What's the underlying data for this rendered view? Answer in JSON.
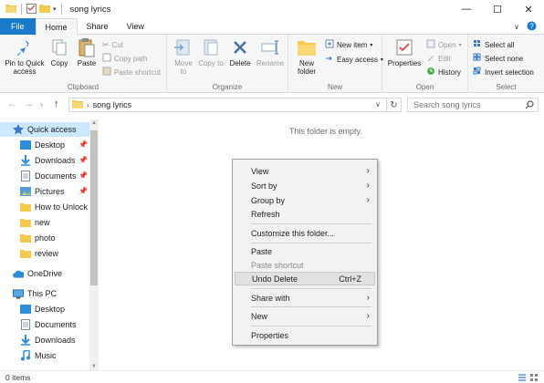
{
  "window": {
    "title": "song lyrics",
    "minimize": "—",
    "maximize": "☐",
    "close": "✕"
  },
  "tabs": [
    "File",
    "Home",
    "Share",
    "View"
  ],
  "ribbon": {
    "clipboard": {
      "label": "Clipboard",
      "pin": "Pin to Quick access",
      "copy": "Copy",
      "paste": "Paste",
      "cut": "Cut",
      "copy_path": "Copy path",
      "paste_shortcut": "Paste shortcut"
    },
    "organize": {
      "label": "Organize",
      "move_to": "Move to",
      "copy_to": "Copy to",
      "delete": "Delete",
      "rename": "Rename"
    },
    "new": {
      "label": "New",
      "new_folder": "New folder",
      "new_item": "New item",
      "easy_access": "Easy access"
    },
    "open": {
      "label": "Open",
      "properties": "Properties",
      "open": "Open",
      "edit": "Edit",
      "history": "History"
    },
    "select": {
      "label": "Select",
      "select_all": "Select all",
      "select_none": "Select none",
      "invert": "Invert selection"
    }
  },
  "address": {
    "path": "song lyrics",
    "search_placeholder": "Search song lyrics"
  },
  "nav": {
    "quick_access": "Quick access",
    "items": [
      {
        "label": "Desktop",
        "pinned": true
      },
      {
        "label": "Downloads",
        "pinned": true
      },
      {
        "label": "Documents",
        "pinned": true
      },
      {
        "label": "Pictures",
        "pinned": true
      },
      {
        "label": "How to Unlock W",
        "pinned": false
      },
      {
        "label": "new",
        "pinned": false
      },
      {
        "label": "photo",
        "pinned": false
      },
      {
        "label": "review",
        "pinned": false
      }
    ],
    "onedrive": "OneDrive",
    "this_pc": "This PC",
    "pc_items": [
      "Desktop",
      "Documents",
      "Downloads",
      "Music"
    ]
  },
  "content": {
    "empty_message": "This folder is empty."
  },
  "context_menu": {
    "view": "View",
    "sort_by": "Sort by",
    "group_by": "Group by",
    "refresh": "Refresh",
    "customize": "Customize this folder...",
    "paste": "Paste",
    "paste_shortcut": "Paste shortcut",
    "undo_delete": "Undo Delete",
    "undo_shortcut": "Ctrl+Z",
    "share_with": "Share with",
    "new": "New",
    "properties": "Properties"
  },
  "status": {
    "count": "0 items"
  },
  "colors": {
    "accent": "#1979ca",
    "selection": "#cce8ff",
    "folder": "#f3c94e"
  }
}
